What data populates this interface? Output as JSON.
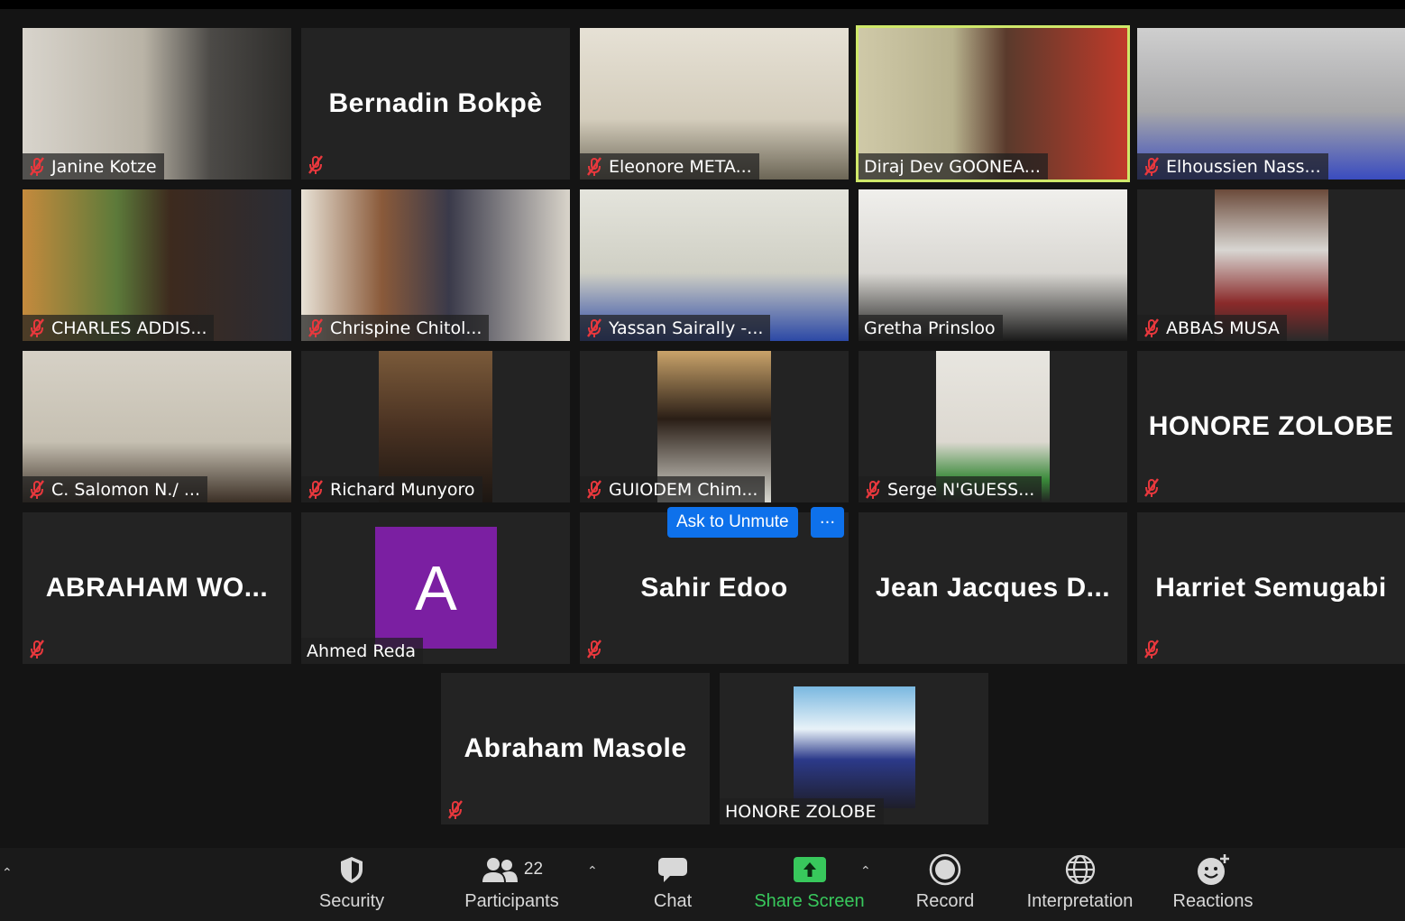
{
  "meeting": {
    "tiles_row1": [
      {
        "name": "Janine Kotze"
      },
      {
        "name": "Bernadin Bokpè"
      },
      {
        "name": "Eleonore META..."
      },
      {
        "name": "Diraj Dev GOONEA..."
      },
      {
        "name": "Elhoussien Nass..."
      }
    ],
    "tiles_row2": [
      {
        "name": "CHARLES ADDIS..."
      },
      {
        "name": "Chrispine Chitol..."
      },
      {
        "name": "Yassan Sairally -..."
      },
      {
        "name": "Gretha Prinsloo"
      },
      {
        "name": "ABBAS MUSA"
      }
    ],
    "tiles_row3": [
      {
        "name": "C. Salomon N./ ..."
      },
      {
        "name": "Richard Munyoro"
      },
      {
        "name": "GUIODEM Chim..."
      },
      {
        "name": "Serge N'GUESS..."
      },
      {
        "name": "HONORE ZOLOBE"
      }
    ],
    "tiles_row4": [
      {
        "name": "ABRAHAM  WO..."
      },
      {
        "name": "Ahmed Reda",
        "avatar_letter": "A"
      },
      {
        "name": "Sahir Edoo"
      },
      {
        "name": "Jean  Jacques  D..."
      },
      {
        "name": "Harriet Semugabi"
      }
    ],
    "tiles_row5": [
      {
        "name": "Abraham Masole"
      },
      {
        "name": "HONORE ZOLOBE"
      }
    ],
    "ask_to_unmute": "Ask to Unmute",
    "more_label": "···"
  },
  "toolbar": {
    "security": "Security",
    "participants": "Participants",
    "participants_count": "22",
    "chat": "Chat",
    "share_screen": "Share Screen",
    "record": "Record",
    "interpretation": "Interpretation",
    "reactions": "Reactions"
  },
  "colors": {
    "active_speaker_border": "#cfe86a",
    "muted_icon": "#e8383d",
    "share_green": "#38c85c",
    "avatar_purple": "#7b1fa2",
    "unmute_blue": "#0e71eb"
  }
}
